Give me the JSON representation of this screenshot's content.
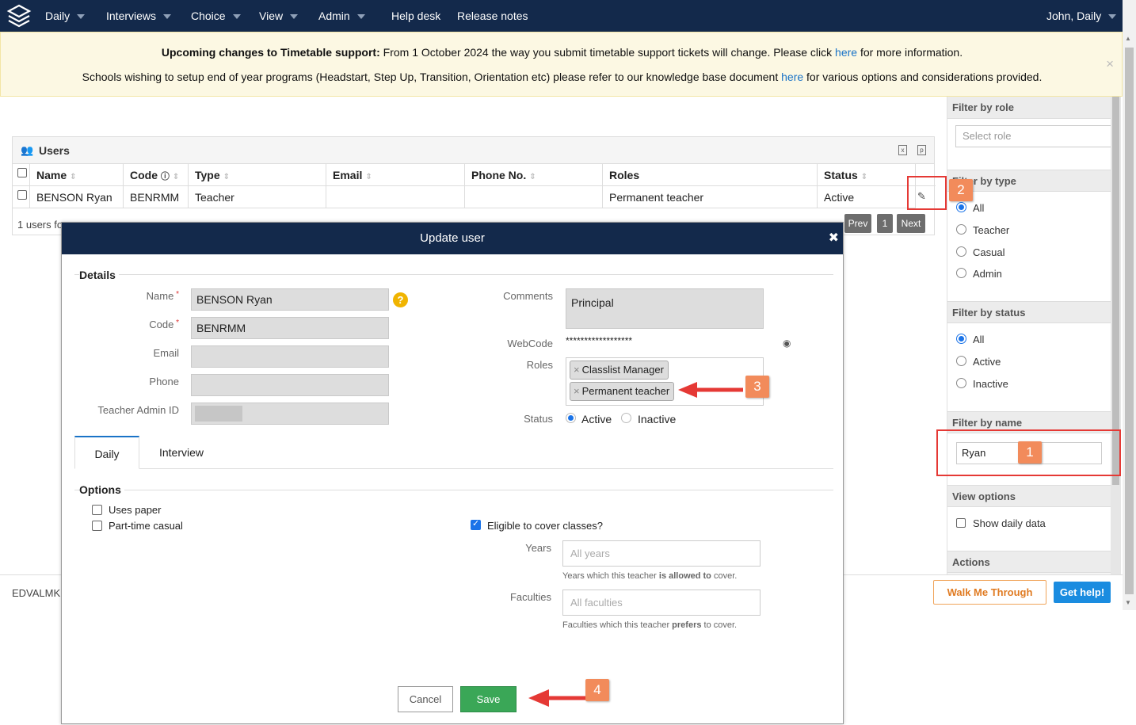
{
  "navbar": {
    "menus": [
      {
        "label": "Daily",
        "has_caret": true
      },
      {
        "label": "Interviews",
        "has_caret": true
      },
      {
        "label": "Choice",
        "has_caret": true
      },
      {
        "label": "View",
        "has_caret": true
      },
      {
        "label": "Admin",
        "has_caret": true
      },
      {
        "label": "Help desk",
        "has_caret": false
      },
      {
        "label": "Release notes",
        "has_caret": false
      }
    ],
    "user_menu": "John, Daily"
  },
  "banner": {
    "line1_bold": "Upcoming changes to Timetable support:",
    "line1_text": " From 1 October 2024 the way you submit timetable support tickets will change. Please click ",
    "line1_link": "here",
    "line1_end": " for more information.",
    "line2_text": "Schools wishing to setup end of year programs (Headstart, Step Up, Transition, Orientation etc) please refer to our knowledge base document ",
    "line2_link": "here",
    "line2_end": " for various options and considerations provided.",
    "close": "×"
  },
  "users": {
    "title": "Users",
    "columns": [
      "Name",
      "Code",
      "Type",
      "Email",
      "Phone No.",
      "Roles",
      "Status"
    ],
    "rows": [
      {
        "name": "BENSON Ryan",
        "code": "BENRMM",
        "type": "Teacher",
        "email": "",
        "phone": "",
        "roles": "Permanent teacher",
        "status": "Active"
      }
    ],
    "footer": "1 users fo",
    "pagination": {
      "prev": "Prev",
      "page": "1",
      "next": "Next"
    }
  },
  "sidebar": {
    "filter_role": {
      "title": "Filter by role",
      "placeholder": "Select role"
    },
    "filter_type": {
      "title": "Filter by type",
      "options": [
        "All",
        "Teacher",
        "Casual",
        "Admin"
      ],
      "selected": "All"
    },
    "filter_status": {
      "title": "Filter by status",
      "options": [
        "All",
        "Active",
        "Inactive"
      ],
      "selected": "All"
    },
    "filter_name": {
      "title": "Filter by name",
      "value": "Ryan"
    },
    "view_options": {
      "title": "View options",
      "show_daily": "Show daily data"
    },
    "actions": {
      "title": "Actions"
    }
  },
  "footer": {
    "brand": "EDVALMK",
    "walk_me": "Walk Me Through",
    "get_help": "Get help!"
  },
  "modal": {
    "title": "Update user",
    "close": "✖",
    "details_legend": "Details",
    "name_label": "Name",
    "name_value": "BENSON Ryan",
    "code_label": "Code",
    "code_value": "BENRMM",
    "email_label": "Email",
    "phone_label": "Phone",
    "teacher_admin_label": "Teacher Admin ID",
    "comments_label": "Comments",
    "comments_value": "Principal",
    "webcode_label": "WebCode",
    "webcode_value": "******************",
    "roles_label": "Roles",
    "roles": [
      "Classlist Manager",
      "Permanent teacher"
    ],
    "status_label": "Status",
    "status_options": [
      "Active",
      "Inactive"
    ],
    "tabs": [
      "Daily",
      "Interview"
    ],
    "options_legend": "Options",
    "uses_paper": "Uses paper",
    "part_time": "Part-time casual",
    "eligible": "Eligible to cover classes?",
    "eligible_checked": true,
    "years_label": "Years",
    "years_placeholder": "All years",
    "years_hint_a": "Years which this teacher ",
    "years_hint_b": "is allowed to",
    "years_hint_c": " cover.",
    "faculties_label": "Faculties",
    "faculties_placeholder": "All faculties",
    "faculties_hint_a": "Faculties which this teacher ",
    "faculties_hint_b": "prefers",
    "faculties_hint_c": " to cover.",
    "cancel": "Cancel",
    "save": "Save"
  },
  "annotations": [
    "1",
    "2",
    "3",
    "4"
  ],
  "colors": {
    "navy": "#13294b",
    "banner": "#fcf8e3",
    "link": "#1a73c7",
    "save": "#3aa757",
    "annotation": "#e53935",
    "badge": "#f28b5b"
  }
}
